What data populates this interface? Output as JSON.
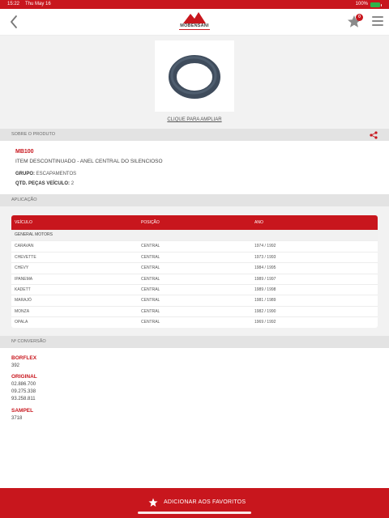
{
  "status_bar": {
    "time": "15:22",
    "date": "Thu May 16",
    "battery": "100%"
  },
  "header": {
    "logo_text": "MOBENSANI",
    "favorites_count": "0"
  },
  "product_image": {
    "zoom_link": "CLIQUE PARA AMPLIAR"
  },
  "about": {
    "section_title": "SOBRE O PRODUTO",
    "code": "MB100",
    "description": "ITEM DESCONTINUADO - ANEL CENTRAL DO SILENCIOSO",
    "group_label": "GRUPO:",
    "group_value": "ESCAPAMENTOS",
    "qty_label": "QTD. PEÇAS VEÍCULO:",
    "qty_value": "2"
  },
  "application": {
    "section_title": "APLICAÇÃO",
    "columns": [
      "VEÍCULO",
      "POSIÇÃO",
      "ANO"
    ],
    "group": "GENERAL MOTORS",
    "rows": [
      {
        "vehicle": "CARAVAN",
        "position": "CENTRAL",
        "year": "1974 / 1992"
      },
      {
        "vehicle": "CHEVETTE",
        "position": "CENTRAL",
        "year": "1973 / 1993"
      },
      {
        "vehicle": "CHEVY",
        "position": "CENTRAL",
        "year": "1984 / 1995"
      },
      {
        "vehicle": "IPANEMA",
        "position": "CENTRAL",
        "year": "1989 / 1997"
      },
      {
        "vehicle": "KADETT",
        "position": "CENTRAL",
        "year": "1989 / 1998"
      },
      {
        "vehicle": "MARAJÓ",
        "position": "CENTRAL",
        "year": "1981 / 1989"
      },
      {
        "vehicle": "MONZA",
        "position": "CENTRAL",
        "year": "1982 / 1990"
      },
      {
        "vehicle": "OPALA",
        "position": "CENTRAL",
        "year": "1969 / 1992"
      }
    ]
  },
  "conversion": {
    "section_title": "Nº CONVERSÃO",
    "brands": [
      {
        "name": "BORFLEX",
        "codes": [
          "392"
        ]
      },
      {
        "name": "ORIGINAL",
        "codes": [
          "02.886.700",
          "09.275.338",
          "93.258.811"
        ]
      },
      {
        "name": "SAMPEL",
        "codes": [
          "3718"
        ]
      }
    ]
  },
  "footer": {
    "label": "ADICIONAR AOS FAVORITOS"
  },
  "colors": {
    "brand_red": "#c8161d",
    "section_gray": "#e3e3e3",
    "battery_green": "#2fb34a"
  },
  "icons": [
    "back-chevron-icon",
    "star-icon",
    "hamburger-menu-icon",
    "share-icon",
    "oring-image"
  ]
}
